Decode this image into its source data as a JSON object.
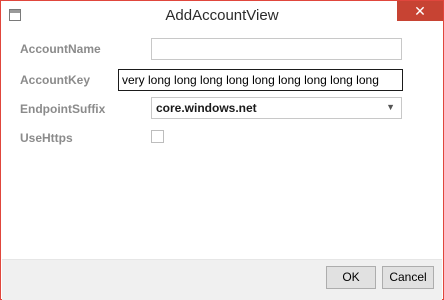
{
  "window": {
    "title": "AddAccountView",
    "close_glyph": "✕"
  },
  "form": {
    "account_name": {
      "label": "AccountName",
      "value": ""
    },
    "account_key": {
      "label": "AccountKey",
      "value": "very long long long long long long long long long"
    },
    "endpoint_suffix": {
      "label": "EndpointSuffix",
      "value": "core.windows.net",
      "arrow": "▼"
    },
    "use_https": {
      "label": "UseHttps",
      "checked": false
    }
  },
  "buttons": {
    "ok": "OK",
    "cancel": "Cancel"
  },
  "colors": {
    "accent_border": "#e0463c",
    "close_button": "#c74333",
    "label_text": "#8b8b8b"
  }
}
